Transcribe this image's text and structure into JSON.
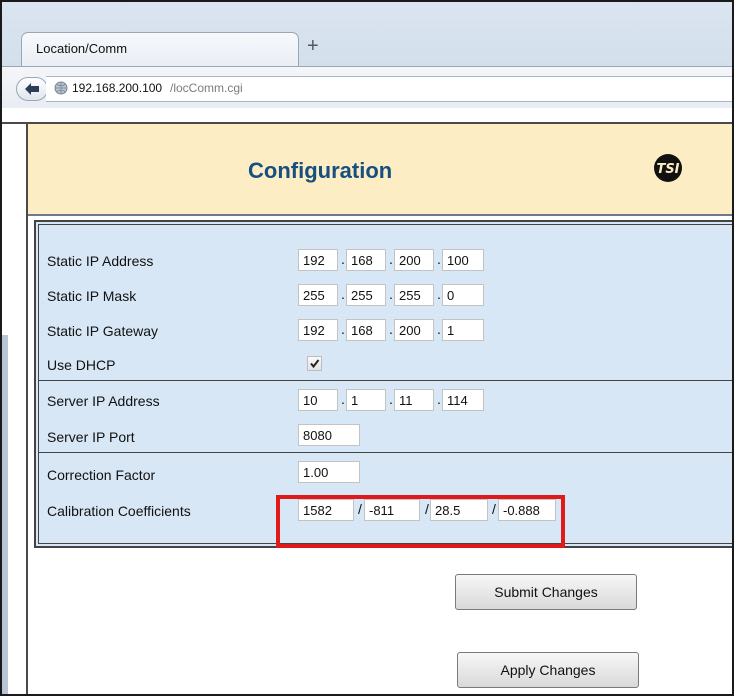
{
  "browser": {
    "tab_title": "Location/Comm",
    "new_tab_symbol": "+",
    "url_host": "192.168.200.100",
    "url_path": "/locComm.cgi"
  },
  "page": {
    "title": "Configuration",
    "logo_icon": "tsi-logo"
  },
  "form": {
    "static_ip": {
      "label": "Static IP Address",
      "octets": [
        "192",
        "168",
        "200",
        "100"
      ]
    },
    "static_mask": {
      "label": "Static IP Mask",
      "octets": [
        "255",
        "255",
        "255",
        "0"
      ]
    },
    "static_gateway": {
      "label": "Static IP Gateway",
      "octets": [
        "192",
        "168",
        "200",
        "1"
      ]
    },
    "use_dhcp": {
      "label": "Use DHCP",
      "checked": true
    },
    "server_ip": {
      "label": "Server IP Address",
      "octets": [
        "10",
        "1",
        "11",
        "114"
      ]
    },
    "server_port": {
      "label": "Server IP Port",
      "value": "8080"
    },
    "correction": {
      "label": "Correction Factor",
      "value": "1.00"
    },
    "calibration": {
      "label": "Calibration Coefficients",
      "values": [
        "1582",
        "-811",
        "28.5",
        "-0.888"
      ]
    }
  },
  "buttons": {
    "submit": "Submit Changes",
    "apply": "Apply Changes"
  },
  "colors": {
    "header_bg": "#fdedc4",
    "title_blue": "#174f81",
    "form_bg": "#d8e7f5",
    "highlight_red": "#e01a1a"
  }
}
